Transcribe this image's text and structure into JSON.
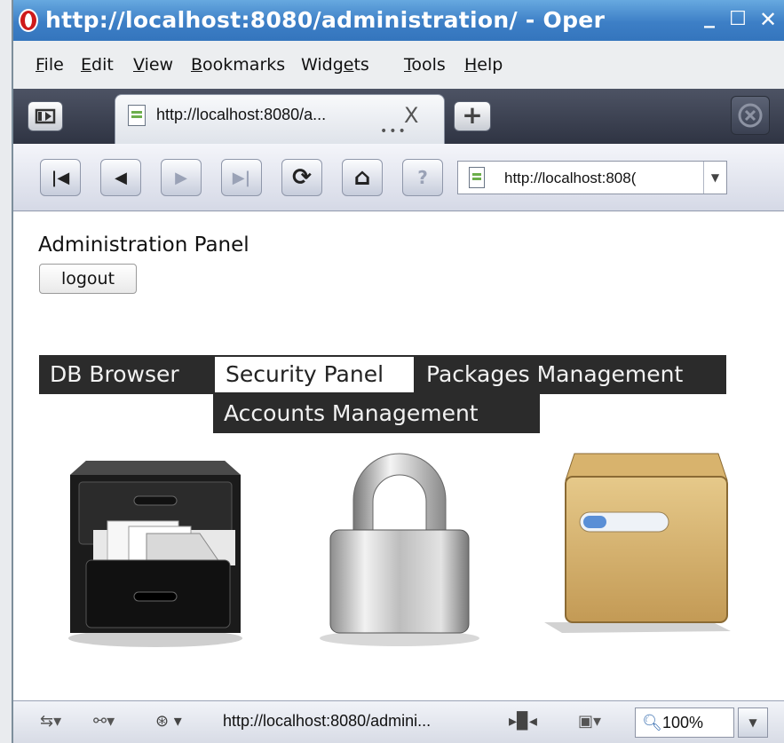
{
  "window": {
    "title": "http://localhost:8080/administration/ - Oper",
    "controls": {
      "minimize": "_",
      "maximize": "☐",
      "close": "✕"
    }
  },
  "menubar": [
    {
      "label": "File",
      "ul": "F",
      "rest": "ile"
    },
    {
      "label": "Edit",
      "ul": "E",
      "rest": "dit"
    },
    {
      "label": "View",
      "ul": "V",
      "rest": "iew"
    },
    {
      "label": "Bookmarks",
      "ul": "B",
      "rest": "ookmarks"
    },
    {
      "label": "Widgets",
      "pre": "Widg",
      "ul": "e",
      "rest": "ts"
    },
    {
      "label": "Tools",
      "ul": "T",
      "rest": "ools"
    },
    {
      "label": "Help",
      "ul": "H",
      "rest": "elp"
    }
  ],
  "tabs": {
    "active_tab": "http://localhost:8080/a...",
    "close": "X",
    "dots": "•••",
    "new_tab": "+"
  },
  "nav": {
    "first": "|◀",
    "back": "◀",
    "forward": "▶",
    "last": "▶|",
    "reload": "⟳",
    "home": "⌂",
    "wand": "?",
    "address": "http://localhost:8080/administration/",
    "address_display": "http://localhost:808(",
    "dropdown": "▼"
  },
  "page": {
    "heading": "Administration Panel",
    "logout": "logout",
    "menu": [
      {
        "label": "DB Browser",
        "active": false
      },
      {
        "label": "Security Panel",
        "active": true
      },
      {
        "label": "Packages Management",
        "active": false
      },
      {
        "label": "Accounts Management",
        "active": false
      }
    ],
    "icons": [
      "file-cabinet-icon",
      "padlock-icon",
      "package-box-icon"
    ]
  },
  "statusbar": {
    "url": "http://localhost:8080/admini...",
    "zoom": "100%",
    "zoom_dropdown": "▼"
  },
  "colors": {
    "menu_bg": "#2b2b2b",
    "menu_text": "#f2f2f2",
    "title_bar": "#3d7fc6",
    "tab_bar": "#2f3443"
  }
}
